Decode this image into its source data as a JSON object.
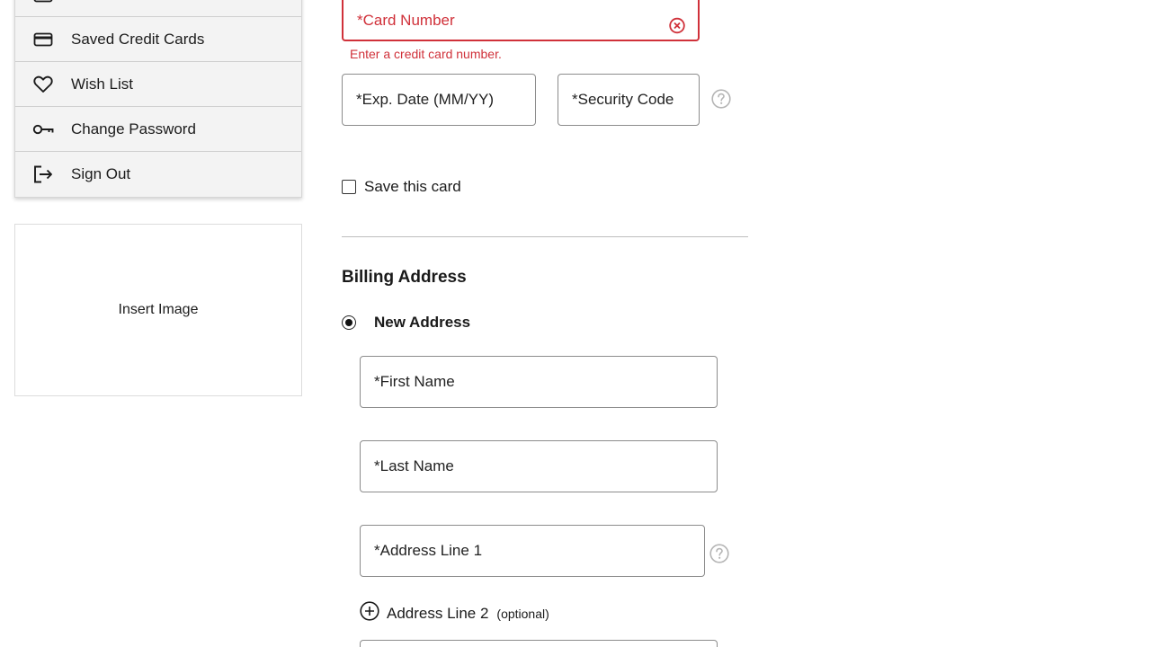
{
  "sidebar": {
    "items": [
      {
        "label": "",
        "icon": "box-icon"
      },
      {
        "label": "Saved Credit Cards",
        "icon": "credit-card-icon"
      },
      {
        "label": "Wish List",
        "icon": "heart-icon"
      },
      {
        "label": "Change Password",
        "icon": "key-icon"
      },
      {
        "label": "Sign Out",
        "icon": "sign-out-icon"
      }
    ],
    "insert_image": "Insert Image"
  },
  "payment": {
    "card_number_placeholder": "*Card Number",
    "card_number_error": "Enter a credit card number.",
    "exp_date_placeholder": "*Exp. Date (MM/YY)",
    "security_code_placeholder": "*Security Code",
    "save_card_label": "Save this card",
    "save_card_checked": false
  },
  "billing": {
    "title": "Billing Address",
    "option_label": "New Address",
    "option_selected": true,
    "first_name_placeholder": "*First Name",
    "last_name_placeholder": "*Last Name",
    "address1_placeholder": "*Address Line 1",
    "address2_label": "Address Line 2",
    "address2_optional": "(optional)"
  },
  "colors": {
    "error": "#d0313a",
    "border": "#8c8c8c",
    "menu_bg": "#f3f3f3"
  }
}
